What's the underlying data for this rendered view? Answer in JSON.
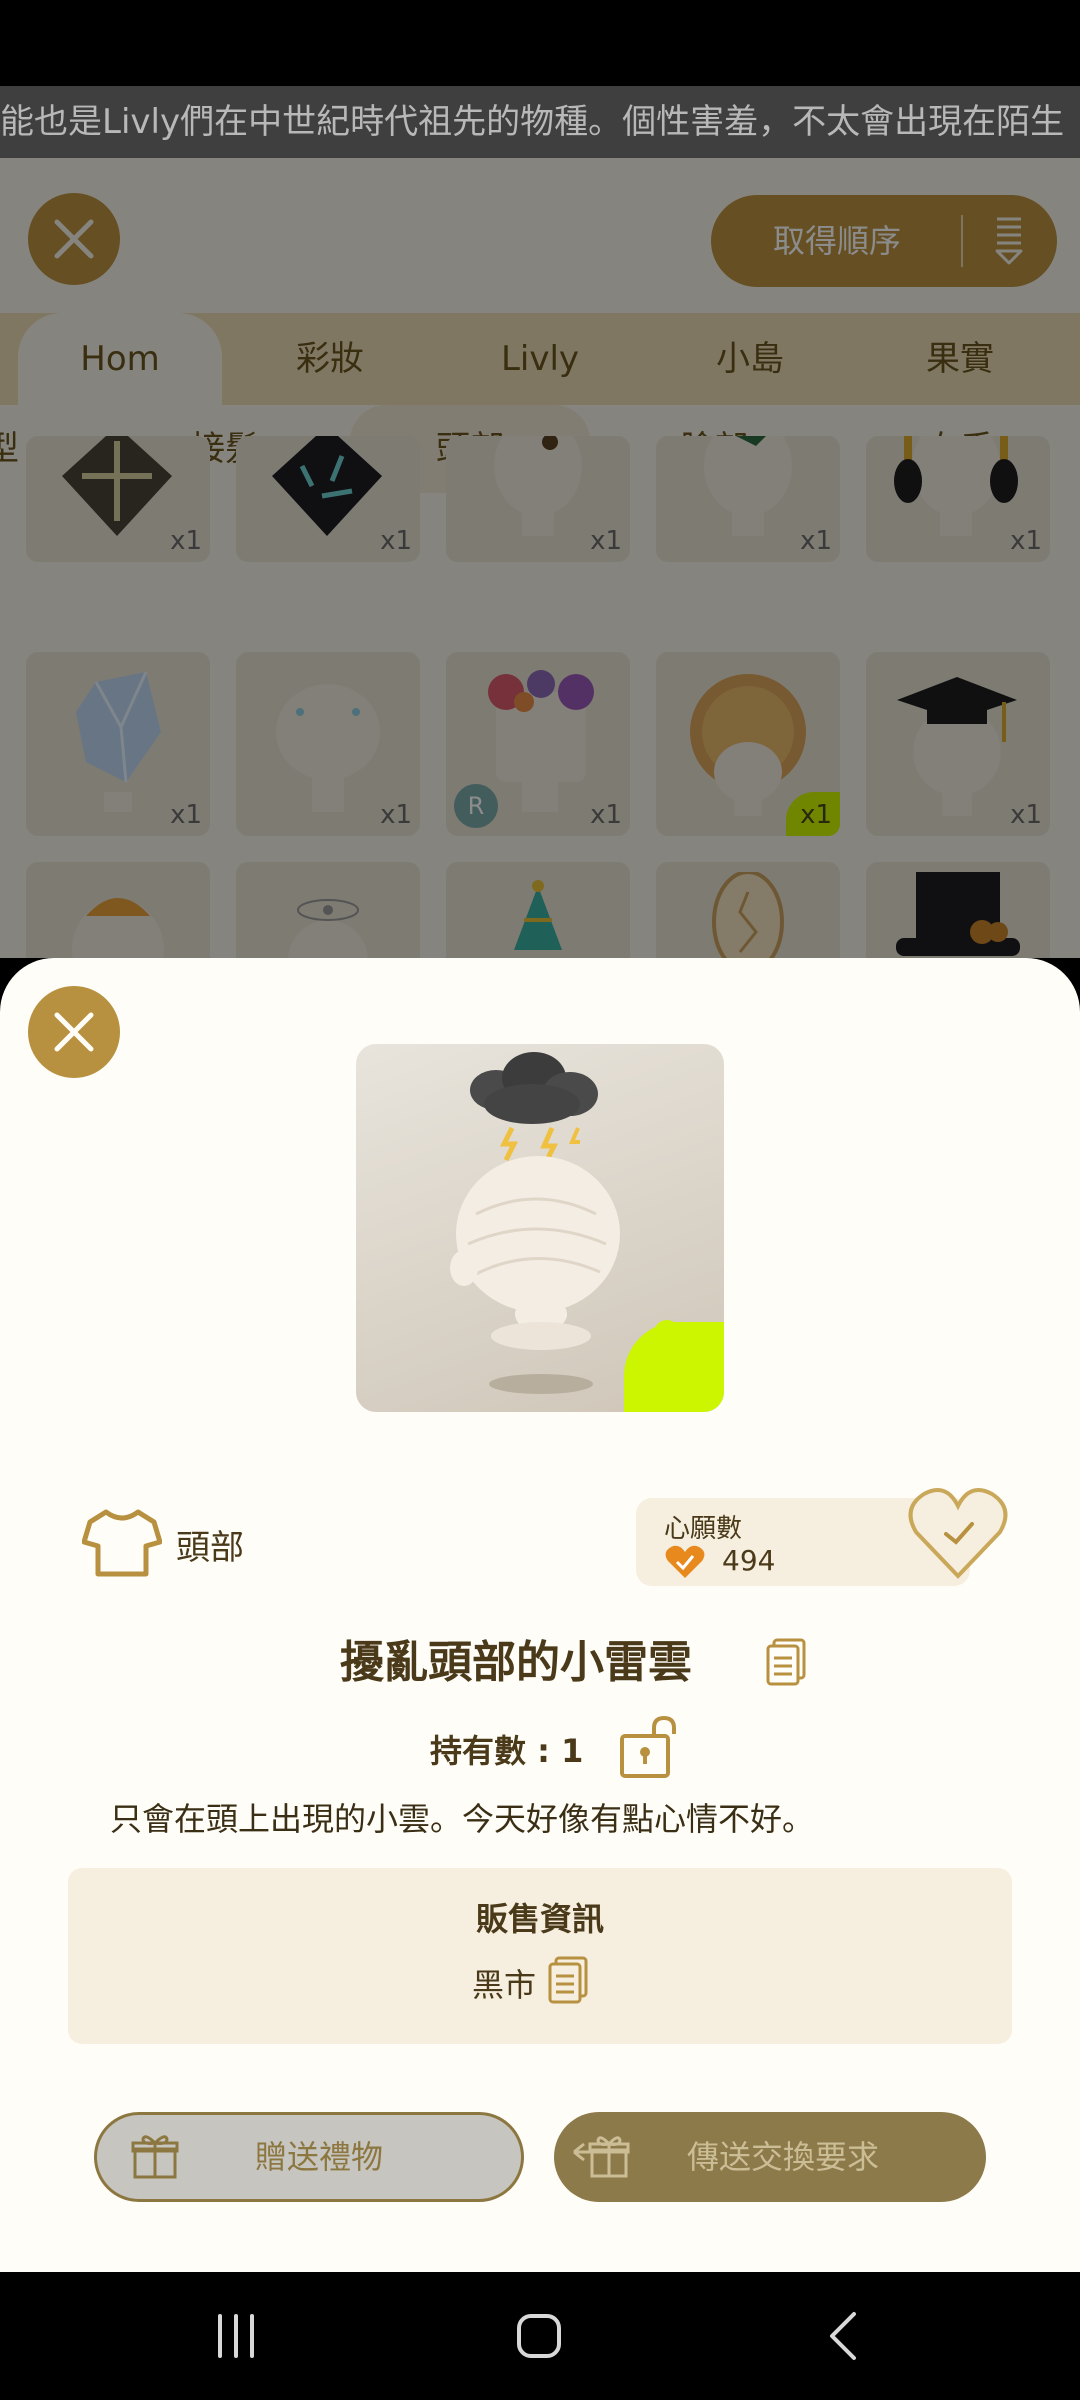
{
  "ticker": {
    "text": "能也是Livly們在中世紀時代祖先的物種。個性害羞，不太會出現在陌生"
  },
  "top": {
    "sort_label": "取得順序",
    "tabs_primary": [
      "Hom",
      "彩妝",
      "Livly",
      "小島",
      "果實"
    ],
    "tabs_secondary": [
      "型",
      "接髮",
      "頭部",
      "臉部",
      "右手"
    ]
  },
  "grid": {
    "quantity_label": "x1",
    "rare_badge": "R"
  },
  "detail": {
    "category": "頭部",
    "wish_label": "心願數",
    "wish_count": "494",
    "item_name": "擾亂頭部的小雷雲",
    "owned": "持有數 : 1",
    "description": "只會在頭上出現的小雲。今天好像有點心情不好。",
    "sale_title": "販售資訊",
    "sale_source": "黑市",
    "gift_button": "贈送禮物",
    "trade_button": "傳送交換要求"
  },
  "colors": {
    "accent": "#b89140",
    "lime": "#ccf500",
    "text": "#4a3a1a"
  }
}
